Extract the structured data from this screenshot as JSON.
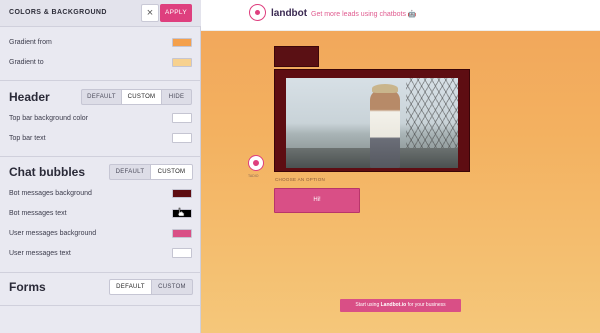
{
  "panel": {
    "title": "COLORS & BACKGROUND",
    "close_glyph": "×",
    "apply_label": "APPLY",
    "gradient": [
      {
        "label": "Gradient from",
        "color": "#f4a04c"
      },
      {
        "label": "Gradient to",
        "color": "#f7d18f"
      }
    ],
    "header": {
      "title": "Header",
      "options": [
        "DEFAULT",
        "CUSTOM",
        "HIDE"
      ],
      "active": "CUSTOM",
      "rows": [
        {
          "label": "Top bar background color",
          "color": "#ffffff"
        },
        {
          "label": "Top bar text",
          "color": "#ffffff"
        }
      ]
    },
    "chat_bubbles": {
      "title": "Chat bubbles",
      "options": [
        "DEFAULT",
        "CUSTOM"
      ],
      "active": "CUSTOM",
      "rows": [
        {
          "label": "Bot messages background",
          "color": "#5e0d12"
        },
        {
          "label": "Bot messages text",
          "color": "#000000"
        },
        {
          "label": "User messages background",
          "color": "#d94f86"
        },
        {
          "label": "User messages text",
          "color": "#ffffff"
        }
      ]
    },
    "forms": {
      "title": "Forms",
      "options": [
        "DEFAULT",
        "CUSTOM"
      ],
      "active": "DEFAULT"
    }
  },
  "preview": {
    "brand": "landbot",
    "tagline": "Get more leads using chatbots 🤖",
    "avatar_label": "TADIO",
    "choose_label": "CHOOSE AN OPTION",
    "option_label": "Hi!",
    "cta_prefix": "Start using ",
    "cta_brand": "Landbot.io",
    "cta_suffix": " for your business"
  },
  "colors": {
    "accent": "#de3f7e",
    "bot_bubble": "#5e0d12",
    "user_bubble": "#d94f86"
  }
}
